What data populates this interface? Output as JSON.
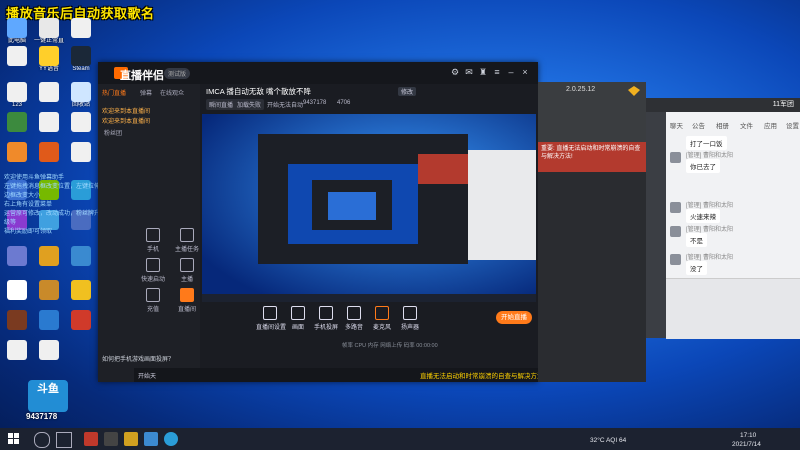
{
  "overlay_title": "播放音乐后自动获取歌名",
  "desktop_icons": [
    {
      "label": "此电脑",
      "color": "#5fa8ff"
    },
    {
      "label": "一键正常直播",
      "color": "#e8e8e8"
    },
    {
      "label": "",
      "color": "#f0f0f0"
    },
    {
      "label": "",
      "color": "#f0f0f0"
    },
    {
      "label": "YY语音",
      "color": "#ffcf2a"
    },
    {
      "label": "Steam",
      "color": "#1b2838"
    },
    {
      "label": "123",
      "color": "#f0f0f0"
    },
    {
      "label": "",
      "color": "#f0f0f0"
    },
    {
      "label": "回收站",
      "color": "#cfe6ff"
    },
    {
      "label": "",
      "color": "#3c8a3e"
    },
    {
      "label": "",
      "color": "#f0f0f0"
    },
    {
      "label": "",
      "color": "#f0f0f0"
    },
    {
      "label": "",
      "color": "#f08a2a"
    },
    {
      "label": "",
      "color": "#e05a1a"
    },
    {
      "label": "",
      "color": "#f0f0f0"
    },
    {
      "label": "",
      "color": "#3a6ed0"
    },
    {
      "label": "",
      "color": "#76b900"
    },
    {
      "label": "",
      "color": "#2a9dd8"
    },
    {
      "label": "",
      "color": "#8a3ad0"
    },
    {
      "label": "",
      "color": "#3fa0e0"
    },
    {
      "label": "",
      "color": "#4a6cc0"
    },
    {
      "label": "",
      "color": "#6c7ad0"
    },
    {
      "label": "",
      "color": "#e0a020"
    },
    {
      "label": "",
      "color": "#3a8ad0"
    },
    {
      "label": "",
      "color": "#ffffff"
    },
    {
      "label": "",
      "color": "#c98a2a"
    },
    {
      "label": "",
      "color": "#f0c020"
    },
    {
      "label": "",
      "color": "#7a3a20"
    },
    {
      "label": "",
      "color": "#2a7ad0"
    },
    {
      "label": "",
      "color": "#d03a2a"
    },
    {
      "label": "",
      "color": "#f0f0f0"
    },
    {
      "label": "",
      "color": "#f0f0f0"
    }
  ],
  "desktop_overlay_text": [
    "欢迎使用斗鱼弹幕助手",
    "左键拖拽消息框改变位置，左键拉伸边框改变大小",
    "右上角有设置菜单",
    "运营原可修改，改动成功，粉丝牌升级等",
    "福利奖励即可领取"
  ],
  "app": {
    "logo": "直播伴侣",
    "version": "测试版",
    "side_tabs": [
      "热门直播",
      "弹幕",
      "在线观众"
    ],
    "chat_lines": [
      {
        "tag": "",
        "text": "欢迎来到本直播间"
      },
      {
        "tag": "",
        "text": "欢迎来到本直播间"
      }
    ],
    "fans_label": "粉丝团",
    "stream_title": "IMCA 播自动无敌 嘴个散放不降",
    "title_tag": "修改",
    "meta": [
      "瞬间直播",
      "加载失败",
      "开始无法自动",
      "9437178",
      "4706"
    ],
    "left_tools": [
      "手机",
      "主播任务",
      "快速启动",
      "主播",
      "充值",
      "直播间"
    ],
    "controls": [
      "直播间设置",
      "画面",
      "手机投屏",
      "多路音",
      "麦克风",
      "扬声器"
    ],
    "start_button": "开始直播",
    "status": "帧率 CPU 内存 网络上传 码率 00:00:00",
    "notice": "直播无法启动和时常崩溃的自查与解决方法",
    "bottom_user": "开始天"
  },
  "tutorial": {
    "version": "2.0.25.12",
    "red_text": "重要: 直播无法启动和时常崩溃的自查与解决方法!"
  },
  "chat_window": {
    "title": "11军团",
    "tabs": [
      "聊天",
      "公告",
      "相册",
      "文件",
      "应用",
      "设置"
    ],
    "messages": [
      {
        "name": "",
        "text": "打了一口饭"
      },
      {
        "name": "[管理] 曹阳和太阳",
        "text": "你已去了"
      },
      {
        "name": "[管理] 曹阳和太阳",
        "text": "火速来辣"
      },
      {
        "name": "[管理] 曹阳和太阳",
        "text": "不是"
      },
      {
        "name": "[管理] 曹阳和太阳",
        "text": "没了"
      }
    ]
  },
  "douyu_badge": {
    "label": "斗鱼",
    "room": "9437178"
  },
  "taskbar": {
    "weather": "32°C AQI 64",
    "time": "17:10",
    "date": "2021/7/14"
  }
}
